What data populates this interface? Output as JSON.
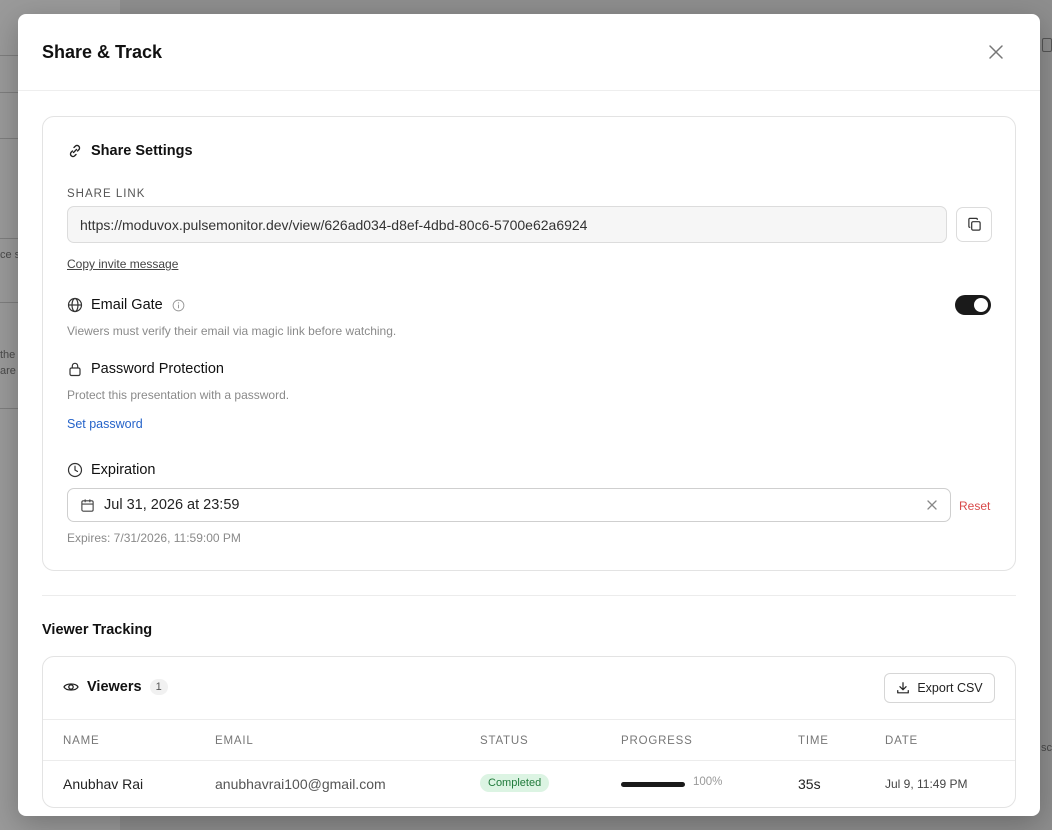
{
  "background": {
    "snippets": [
      "ce s",
      "the",
      "are",
      "sc"
    ]
  },
  "modal": {
    "title": "Share & Track"
  },
  "share_settings": {
    "title": "Share Settings",
    "link_label": "SHARE LINK",
    "link_value": "https://moduvox.pulsemonitor.dev/view/626ad034-d8ef-4dbd-80c6-5700e62a6924",
    "copy_invite": "Copy invite message",
    "email_gate": {
      "label": "Email Gate",
      "hint": "Viewers must verify their email via magic link before watching.",
      "enabled": true
    },
    "password": {
      "label": "Password Protection",
      "hint": "Protect this presentation with a password.",
      "action": "Set password"
    },
    "expiration": {
      "label": "Expiration",
      "value": "Jul 31, 2026 at 23:59",
      "reset": "Reset",
      "expires_text": "Expires: 7/31/2026, 11:59:00 PM"
    }
  },
  "viewer_tracking": {
    "title": "Viewer Tracking",
    "viewers_label": "Viewers",
    "viewers_count": "1",
    "export_label": "Export CSV",
    "columns": [
      "NAME",
      "EMAIL",
      "STATUS",
      "PROGRESS",
      "TIME",
      "DATE"
    ],
    "rows": [
      {
        "name": "Anubhav Rai",
        "email": "anubhavrai100@gmail.com",
        "status": "Completed",
        "progress": 100,
        "progress_text": "100%",
        "time": "35s",
        "date": "Jul 9, 11:49 PM"
      }
    ]
  },
  "colors": {
    "toggle_on": "#1a1a1a",
    "link_blue": "#2563c9",
    "reset_red": "#d84a4a",
    "status_green_bg": "#dcf4e3",
    "status_green_text": "#1f7a3a"
  }
}
